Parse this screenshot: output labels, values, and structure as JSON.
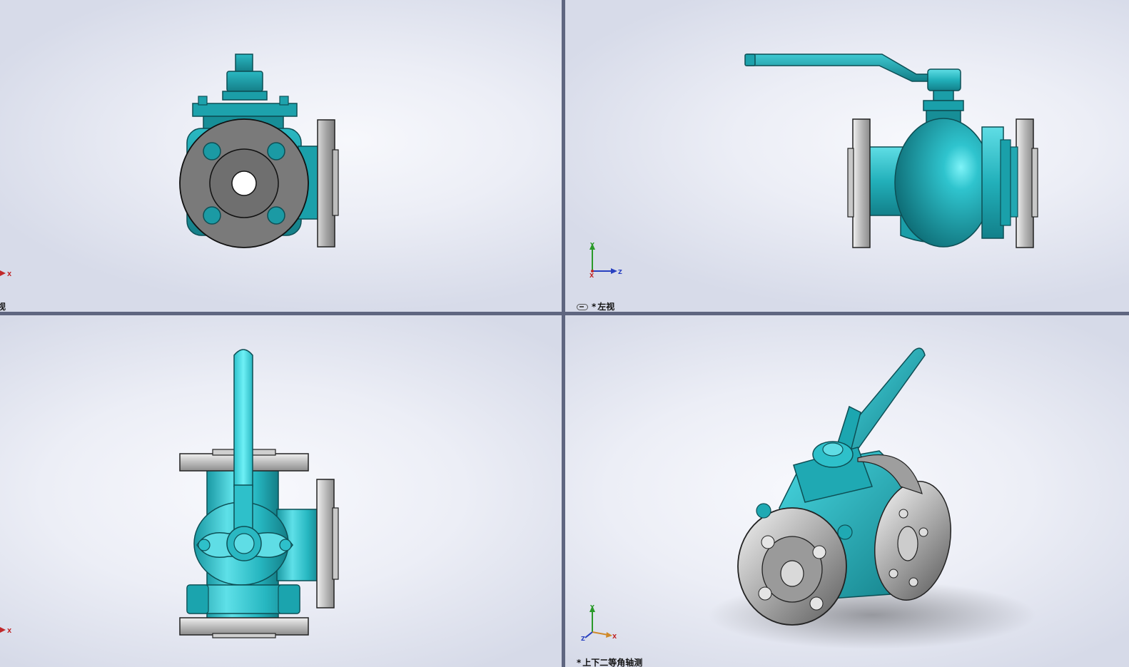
{
  "viewports": {
    "top_left": {
      "label": "视",
      "star": "",
      "triad_axes": [
        "X"
      ]
    },
    "top_right": {
      "label": "左视",
      "star": "*",
      "triad_axes": [
        "Y",
        "Z",
        "X"
      ]
    },
    "bottom_left": {
      "label": "",
      "star": "",
      "triad_axes": [
        "X"
      ]
    },
    "bottom_right": {
      "label": "上下二等角轴测",
      "star": "*",
      "triad_axes": [
        "Y",
        "Z",
        "X"
      ]
    }
  },
  "model": {
    "name": "three-way-ball-valve",
    "body_color": "#1a9aa5",
    "highlight_color": "#48d8e2",
    "flange_color": "#8c8c8c",
    "flange_highlight": "#c9c9c9"
  },
  "colors": {
    "axis_x": "#c0282a",
    "axis_y": "#2a9a2a",
    "axis_z": "#2840c0",
    "divider": "#5f6680"
  }
}
